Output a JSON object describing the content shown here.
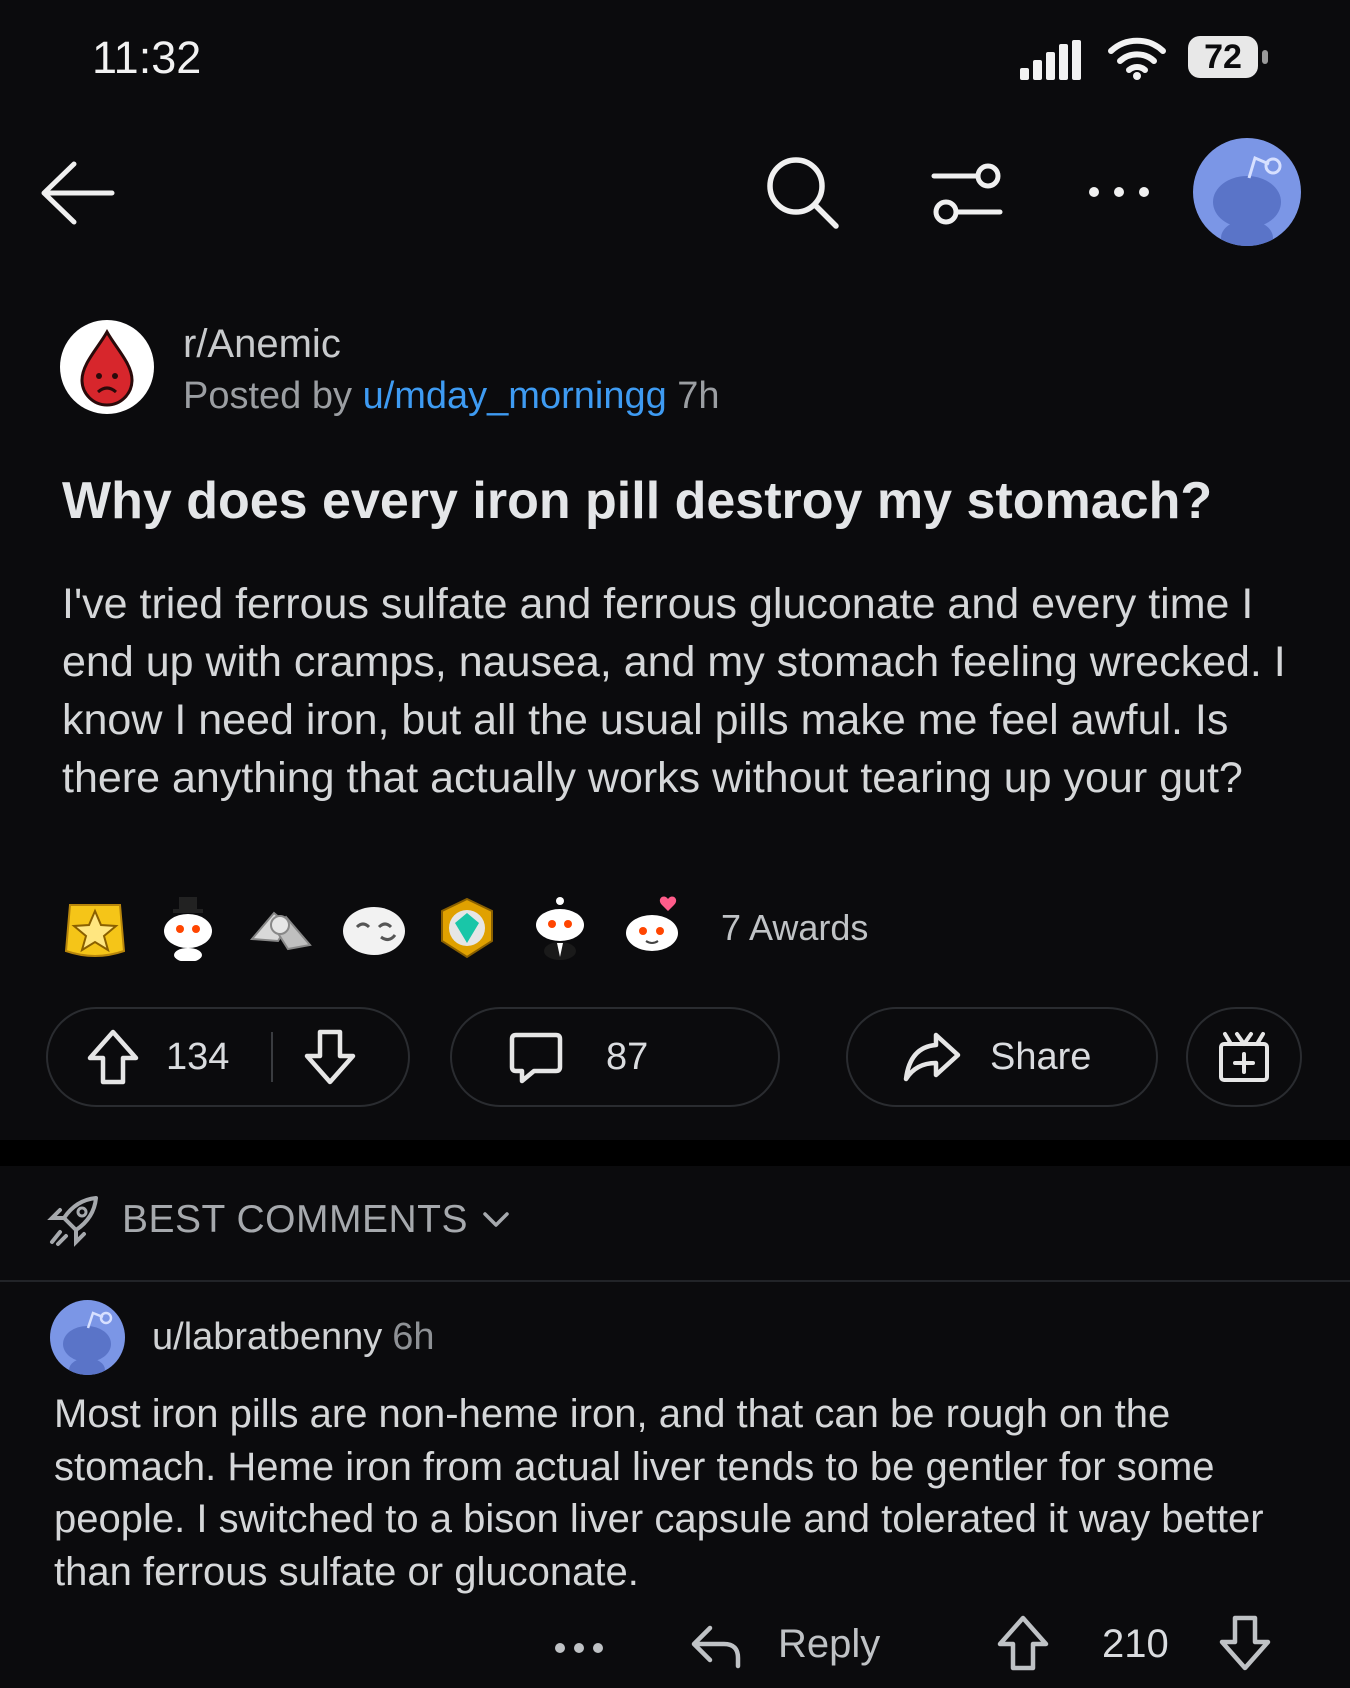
{
  "status_bar": {
    "time": "11:32",
    "battery": "72"
  },
  "post": {
    "subreddit": "r/Anemic",
    "posted_by_prefix": "Posted by",
    "author": "u/mday_morningg",
    "age": "7h",
    "title": "Why does every iron pill destroy my stomach?",
    "body": "I've tried ferrous sulfate and ferrous gluconate and every time I end up with cramps, nausea, and my stomach feeling wrecked. I know I need iron, but all the usual pills make me feel awful. Is there anything that actually works without tearing up your gut?",
    "awards_count": "7 Awards",
    "upvotes": "134",
    "comments": "87",
    "share_label": "Share"
  },
  "comments_section": {
    "sort_label": "BEST COMMENTS"
  },
  "comment": {
    "author": "u/labratbenny",
    "age": "6h",
    "body": "Most iron pills are non-heme iron, and that can be rough on the stomach. Heme iron from actual liver tends to be gentler for some people. I switched to a bison liver capsule and tolerated it way better than ferrous sulfate or gluconate.",
    "reply_label": "Reply",
    "score": "210"
  },
  "colors": {
    "background": "#0b0b0d",
    "link": "#3e9bf2",
    "avatar": "#7b96e6",
    "subreddit_icon": "#d7262c"
  }
}
